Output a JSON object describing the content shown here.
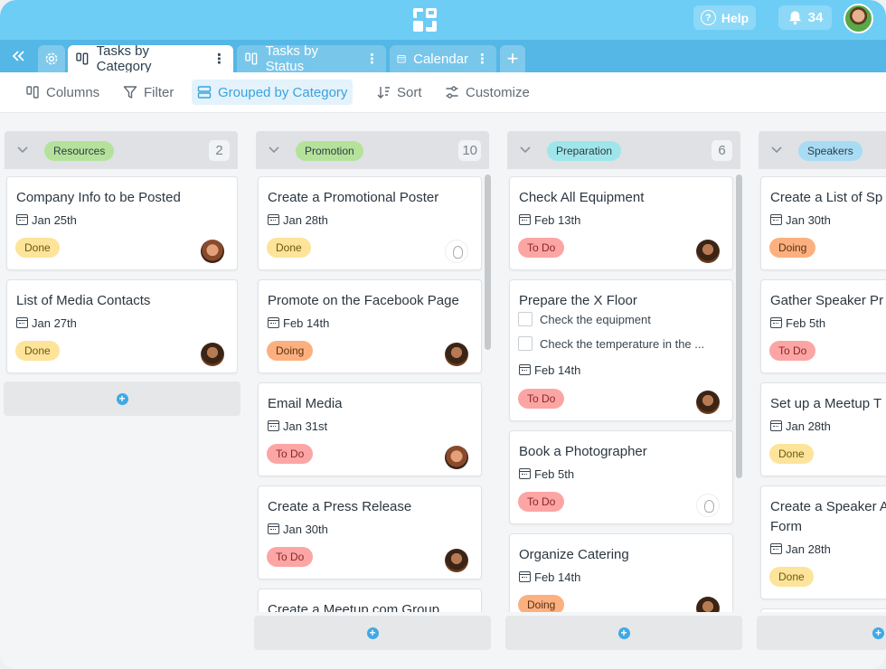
{
  "header": {
    "logo_icon": "app-logo-icon",
    "help_label": "Help",
    "notifications_count": "34"
  },
  "tabs": [
    {
      "label": "Tasks by Category",
      "active": true
    },
    {
      "label": "Tasks by Status",
      "active": false
    },
    {
      "label": "Calendar",
      "active": false
    }
  ],
  "toolbar": {
    "columns_label": "Columns",
    "filter_label": "Filter",
    "grouped_label": "Grouped by Category",
    "sort_label": "Sort",
    "customize_label": "Customize"
  },
  "columns": [
    {
      "name": "Resources",
      "count": "2",
      "color": "#b4e29a",
      "cards": [
        {
          "title": "Company Info to be Posted",
          "date": "Jan 25th",
          "status": "Done"
        },
        {
          "title": "List of Media Contacts",
          "date": "Jan 27th",
          "status": "Done"
        }
      ]
    },
    {
      "name": "Promotion",
      "count": "10",
      "color": "#b4e29a",
      "cards": [
        {
          "title": "Create a Promotional Poster",
          "date": "Jan 28th",
          "status": "Done"
        },
        {
          "title": "Promote on the Facebook Page",
          "date": "Feb 14th",
          "status": "Doing"
        },
        {
          "title": "Email Media",
          "date": "Jan 31st",
          "status": "To Do"
        },
        {
          "title": "Create a Press Release",
          "date": "Jan 30th",
          "status": "To Do"
        },
        {
          "title": "Create a Meetup.com Group"
        }
      ]
    },
    {
      "name": "Preparation",
      "count": "6",
      "color": "#9fe6ea",
      "cards": [
        {
          "title": "Check All Equipment",
          "date": "Feb 13th",
          "status": "To Do"
        },
        {
          "title": "Prepare the X Floor",
          "checklist": [
            "Check the equipment",
            "Check the temperature in the ..."
          ],
          "date": "Feb 14th",
          "status": "To Do"
        },
        {
          "title": "Book a Photographer",
          "date": "Feb 5th",
          "status": "To Do"
        },
        {
          "title": "Organize Catering",
          "date": "Feb 14th",
          "status": "Doing"
        }
      ]
    },
    {
      "name": "Speakers",
      "color": "#a8dcf5",
      "cards": [
        {
          "title": "Create a List of Sp",
          "date": "Jan 30th",
          "status": "Doing"
        },
        {
          "title": "Gather Speaker Pr",
          "date": "Feb 5th",
          "status": "To Do"
        },
        {
          "title": "Set up a Meetup T",
          "date": "Jan 28th",
          "status": "Done"
        },
        {
          "title": "Create a Speaker A",
          "title2": "Form",
          "date": "Jan 28th",
          "status": "Done"
        }
      ]
    }
  ]
}
